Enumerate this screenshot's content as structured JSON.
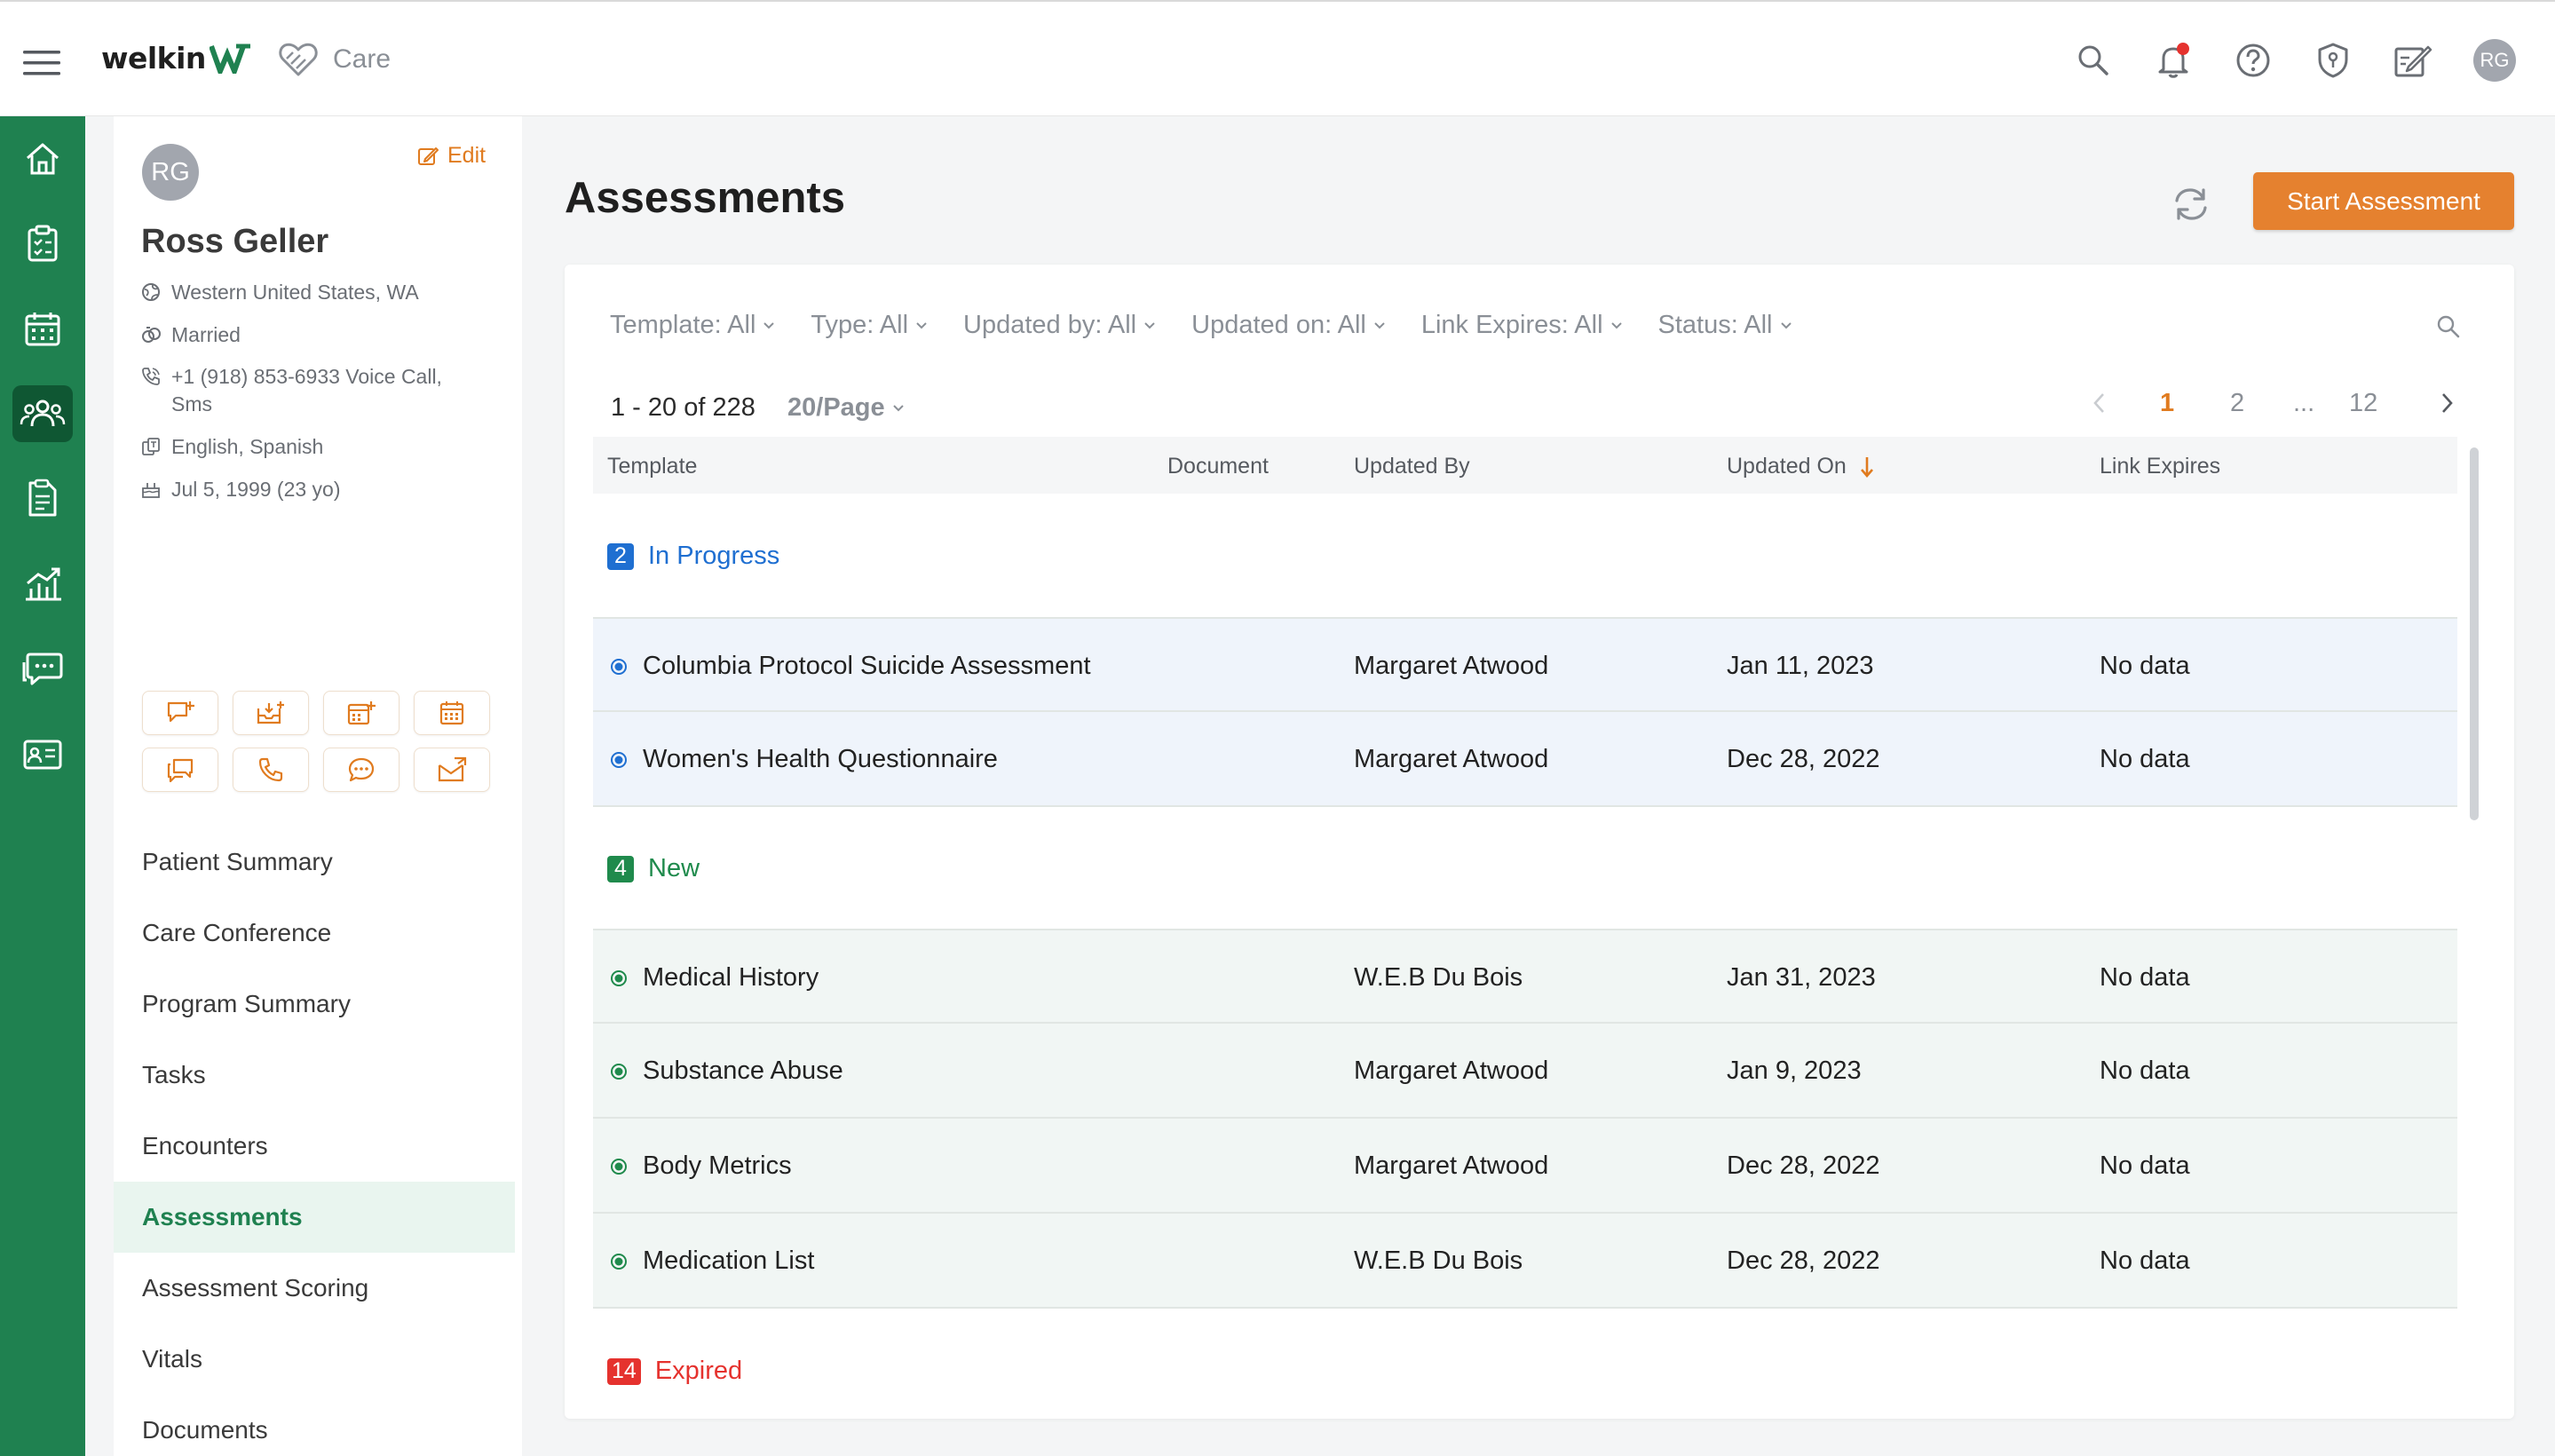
{
  "app": {
    "brand": "welkin",
    "section_label": "Care",
    "user_initials": "RG",
    "colors": {
      "primary_green": "#1f8150",
      "accent_orange": "#e5812f",
      "in_progress_blue": "#1f6fd1",
      "new_green": "#1f8a4c",
      "expired_red": "#e5322e"
    },
    "top_icons": [
      "search-icon",
      "bell-icon",
      "help-icon",
      "shield-icon",
      "edit-notes-icon"
    ],
    "rail_icons": [
      "home-icon",
      "clipboard-icon",
      "calendar-icon",
      "patients-icon",
      "document-icon",
      "analytics-icon",
      "chat-icon",
      "contact-card-icon"
    ],
    "rail_active": "patients-icon"
  },
  "patient": {
    "initials": "RG",
    "edit_label": "Edit",
    "name": "Ross Geller",
    "region": "Western United States, WA",
    "marital_status": "Married",
    "phone_line1": "+1 (918) 853-6933 Voice Call,",
    "phone_line2": "Sms",
    "languages": "English, Spanish",
    "dob": "Jul 5, 1999 (23 yo)",
    "quick_actions": [
      "add-message-icon",
      "add-inbox-icon",
      "add-calendar-icon",
      "calendar-icon",
      "chat-icon",
      "phone-icon",
      "sms-icon",
      "email-icon"
    ],
    "nav": [
      {
        "label": "Patient Summary"
      },
      {
        "label": "Care Conference"
      },
      {
        "label": "Program Summary"
      },
      {
        "label": "Tasks"
      },
      {
        "label": "Encounters"
      },
      {
        "label": "Assessments",
        "active": true
      },
      {
        "label": "Assessment Scoring"
      },
      {
        "label": "Vitals"
      },
      {
        "label": "Documents"
      }
    ]
  },
  "main": {
    "title": "Assessments",
    "start_button": "Start Assessment",
    "filters": [
      "Template: All",
      "Type: All",
      "Updated by: All",
      "Updated on: All",
      "Link Expires: All",
      "Status: All"
    ],
    "range_text": "1 - 20 of 228",
    "per_page": "20/Page",
    "pagination": {
      "pages": [
        "1",
        "2",
        "...",
        "12"
      ],
      "current": "1"
    },
    "columns": [
      "Template",
      "Document",
      "Updated By",
      "Updated On",
      "Link Expires"
    ],
    "sort_column": "Updated On",
    "groups": {
      "in_progress": {
        "count": "2",
        "label": "In Progress",
        "rows": [
          {
            "template": "Columbia Protocol Suicide Assessment",
            "document": "",
            "updated_by": "Margaret Atwood",
            "updated_on": "Jan 11, 2023",
            "link_expires": "No data"
          },
          {
            "template": "Women's Health Questionnaire",
            "document": "",
            "updated_by": "Margaret Atwood",
            "updated_on": "Dec 28, 2022",
            "link_expires": "No data"
          }
        ]
      },
      "new": {
        "count": "4",
        "label": "New",
        "rows": [
          {
            "template": "Medical History",
            "document": "",
            "updated_by": "W.E.B Du Bois",
            "updated_on": "Jan 31, 2023",
            "link_expires": "No data"
          },
          {
            "template": "Substance Abuse",
            "document": "",
            "updated_by": "Margaret Atwood",
            "updated_on": "Jan 9, 2023",
            "link_expires": "No data"
          },
          {
            "template": "Body Metrics",
            "document": "",
            "updated_by": "Margaret Atwood",
            "updated_on": "Dec 28, 2022",
            "link_expires": "No data"
          },
          {
            "template": "Medication List",
            "document": "",
            "updated_by": "W.E.B Du Bois",
            "updated_on": "Dec 28, 2022",
            "link_expires": "No data"
          }
        ]
      },
      "expired": {
        "count": "14",
        "label": "Expired"
      }
    }
  }
}
